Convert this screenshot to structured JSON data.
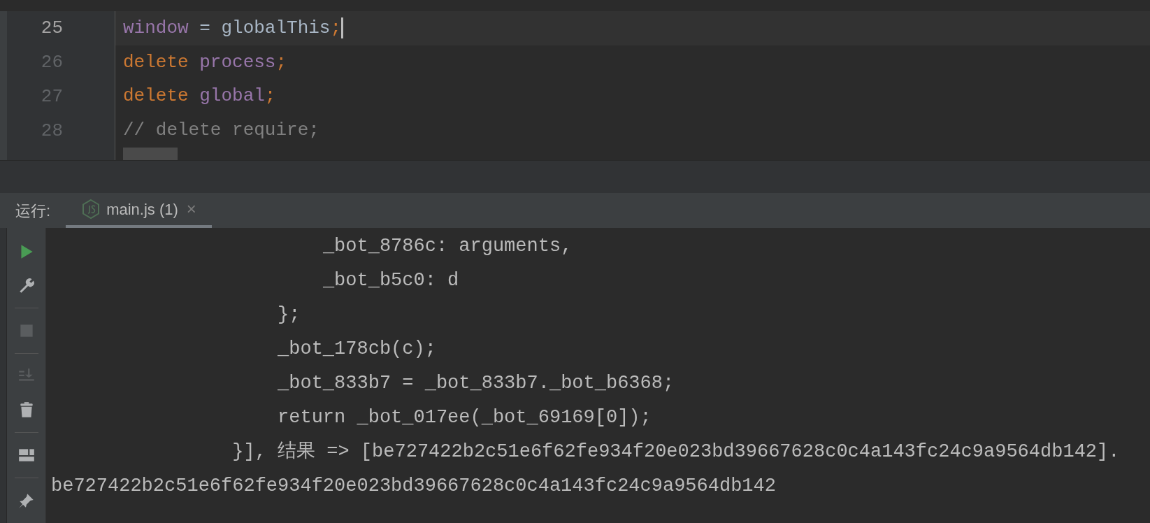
{
  "editor": {
    "lines": [
      {
        "number": "25",
        "current": true,
        "tokens": [
          {
            "kind": "variable",
            "text": "window"
          },
          {
            "kind": "plain",
            "text": " = globalThis"
          },
          {
            "kind": "keyword",
            "text": ";"
          }
        ]
      },
      {
        "number": "26",
        "current": false,
        "tokens": [
          {
            "kind": "keyword",
            "text": "delete "
          },
          {
            "kind": "variable",
            "text": "process"
          },
          {
            "kind": "keyword",
            "text": ";"
          }
        ]
      },
      {
        "number": "27",
        "current": false,
        "tokens": [
          {
            "kind": "keyword",
            "text": "delete "
          },
          {
            "kind": "variable",
            "text": "global"
          },
          {
            "kind": "keyword",
            "text": ";"
          }
        ]
      },
      {
        "number": "28",
        "current": false,
        "tokens": [
          {
            "kind": "comment",
            "text": "// delete require;"
          }
        ]
      }
    ]
  },
  "run_panel": {
    "label": "运行:",
    "tabs": [
      {
        "label": "main.js (1)",
        "selected": true,
        "close": "×"
      }
    ],
    "toolbar": [
      {
        "kind": "run",
        "disabled": false
      },
      {
        "kind": "wrench",
        "disabled": false
      },
      {
        "kind": "stop",
        "disabled": true
      },
      {
        "kind": "scroll",
        "disabled": true
      },
      {
        "kind": "trash",
        "disabled": false
      },
      {
        "kind": "layout",
        "disabled": false
      },
      {
        "kind": "pin",
        "disabled": false
      }
    ],
    "output": [
      "                        _bot_8786c: arguments,",
      "                        _bot_b5c0: d",
      "                    };",
      "                    _bot_178cb(c);",
      "                    _bot_833b7 = _bot_833b7._bot_b6368;",
      "                    return _bot_017ee(_bot_69169[0]);",
      "                }], 结果 => [be727422b2c51e6f62fe934f20e023bd39667628c0c4a143fc24c9a9564db142].",
      "be727422b2c51e6f62fe934f20e023bd39667628c0c4a143fc24c9a9564db142"
    ]
  }
}
